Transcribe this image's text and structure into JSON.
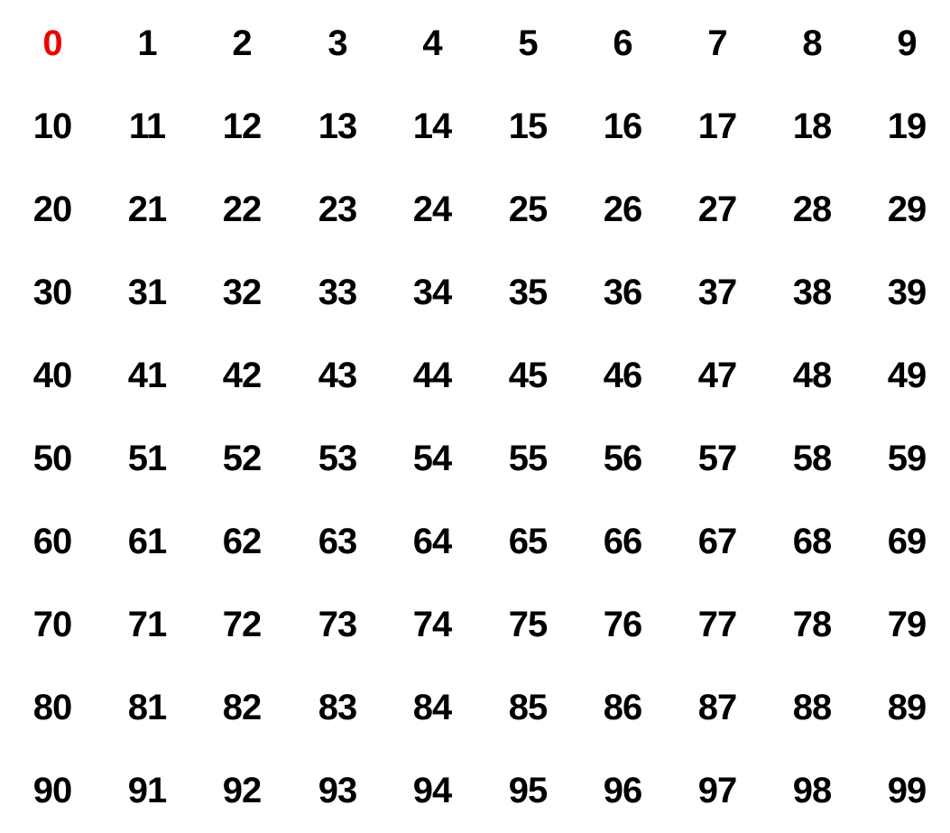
{
  "numbers": [
    [
      "0",
      "1",
      "2",
      "3",
      "4",
      "5",
      "6",
      "7",
      "8",
      "9"
    ],
    [
      "10",
      "11",
      "12",
      "13",
      "14",
      "15",
      "16",
      "17",
      "18",
      "19"
    ],
    [
      "20",
      "21",
      "22",
      "23",
      "24",
      "25",
      "26",
      "27",
      "28",
      "29"
    ],
    [
      "30",
      "31",
      "32",
      "33",
      "34",
      "35",
      "36",
      "37",
      "38",
      "39"
    ],
    [
      "40",
      "41",
      "42",
      "43",
      "44",
      "45",
      "46",
      "47",
      "48",
      "49"
    ],
    [
      "50",
      "51",
      "52",
      "53",
      "54",
      "55",
      "56",
      "57",
      "58",
      "59"
    ],
    [
      "60",
      "61",
      "62",
      "63",
      "64",
      "65",
      "66",
      "67",
      "68",
      "69"
    ],
    [
      "70",
      "71",
      "72",
      "73",
      "74",
      "75",
      "76",
      "77",
      "78",
      "79"
    ],
    [
      "80",
      "81",
      "82",
      "83",
      "84",
      "85",
      "86",
      "87",
      "88",
      "89"
    ],
    [
      "90",
      "91",
      "92",
      "93",
      "94",
      "95",
      "96",
      "97",
      "98",
      "99"
    ]
  ],
  "colors": {
    "default": "#000000",
    "highlight": "#ee0000"
  },
  "highlighted": [
    "0"
  ]
}
